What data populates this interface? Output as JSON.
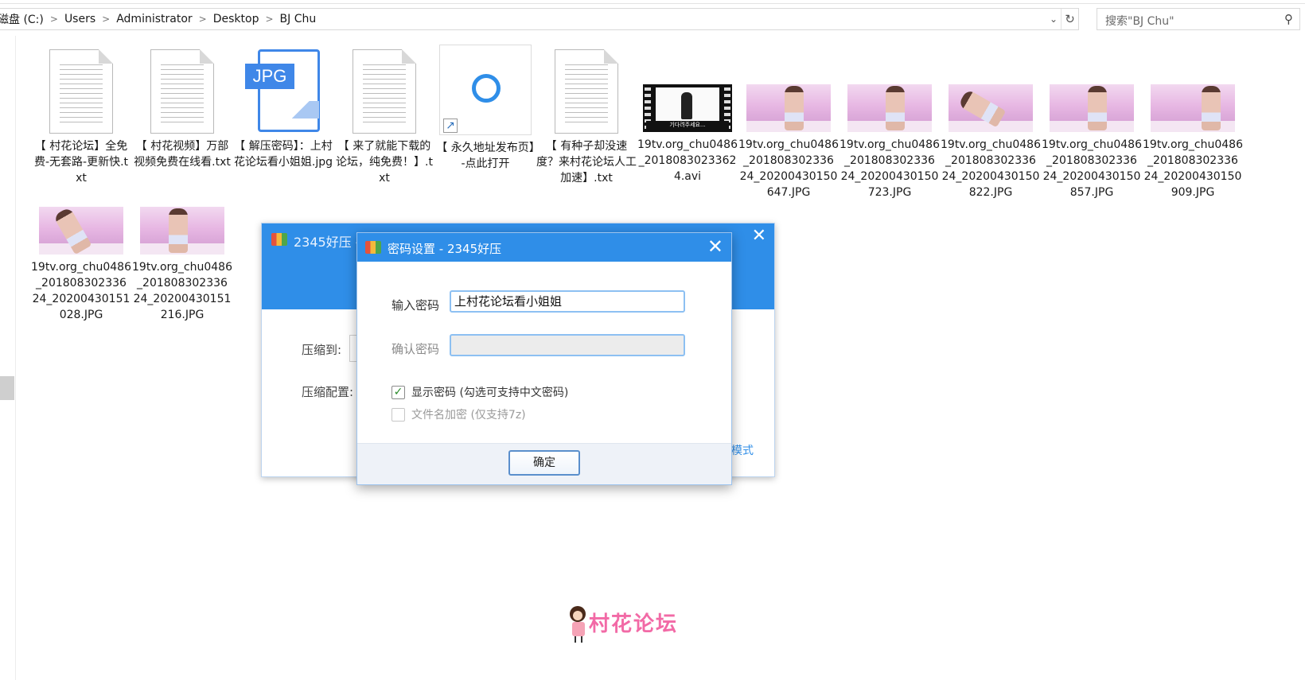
{
  "address": {
    "crumbs": [
      "磁盘 (C:)",
      "Users",
      "Administrator",
      "Desktop",
      "BJ Chu"
    ],
    "separator": ">"
  },
  "search": {
    "placeholder": "搜索\"BJ Chu\""
  },
  "files": [
    {
      "name": "【 村花论坛】全免费-无套路-更新快.txt",
      "kind": "txt"
    },
    {
      "name": "【 村花视频】万部视频免费在线看.txt",
      "kind": "txt"
    },
    {
      "name": "【 解压密码】：上村花论坛看小姐姐.jpg",
      "kind": "jpg",
      "icon_label": "JPG"
    },
    {
      "name": "【 来了就能下载的论坛，纯免费！】.txt",
      "kind": "txt"
    },
    {
      "name": "【 永久地址发布页】-点此打开",
      "kind": "shortcut"
    },
    {
      "name": "【 有种子却没速度？来村花论坛人工加速】.txt",
      "kind": "txt"
    },
    {
      "name": "19tv.org_chu0486_20180830233624.avi",
      "kind": "video",
      "caption": "기다려주세요..."
    },
    {
      "name": "19tv.org_chu0486_201808302336 24_20200430150647.JPG",
      "kind": "photo"
    },
    {
      "name": "19tv.org_chu0486_201808302336 24_20200430150723.JPG",
      "kind": "photo"
    },
    {
      "name": "19tv.org_chu0486_201808302336 24_20200430150822.JPG",
      "kind": "photo"
    },
    {
      "name": "19tv.org_chu0486_201808302336 24_20200430150857.JPG",
      "kind": "photo"
    },
    {
      "name": "19tv.org_chu0486_201808302336 24_20200430150909.JPG",
      "kind": "photo"
    },
    {
      "name": "19tv.org_chu0486_201808302336 24_20200430151028.JPG",
      "kind": "photo"
    },
    {
      "name": "19tv.org_chu0486_201808302336 24_20200430151216.JPG",
      "kind": "photo"
    }
  ],
  "bg_window": {
    "title": "2345好压 -",
    "compress_to_label": "压缩到:",
    "compress_config_label": "压缩配置:",
    "mode_link": "模式"
  },
  "dialog": {
    "title": "密码设置 - 2345好压",
    "password_label": "输入密码",
    "password_value": "上村花论坛看小姐姐",
    "confirm_label": "确认密码",
    "confirm_value": "",
    "show_password": {
      "label": "显示密码 (勾选可支持中文密码)",
      "checked": true
    },
    "encrypt_names": {
      "label": "文件名加密 (仅支持7z)",
      "checked": false
    },
    "ok_label": "确定"
  },
  "watermark": {
    "text": "村花论坛"
  },
  "colors": {
    "accent": "#2f8ee8",
    "watermark": "#f26aa6"
  }
}
